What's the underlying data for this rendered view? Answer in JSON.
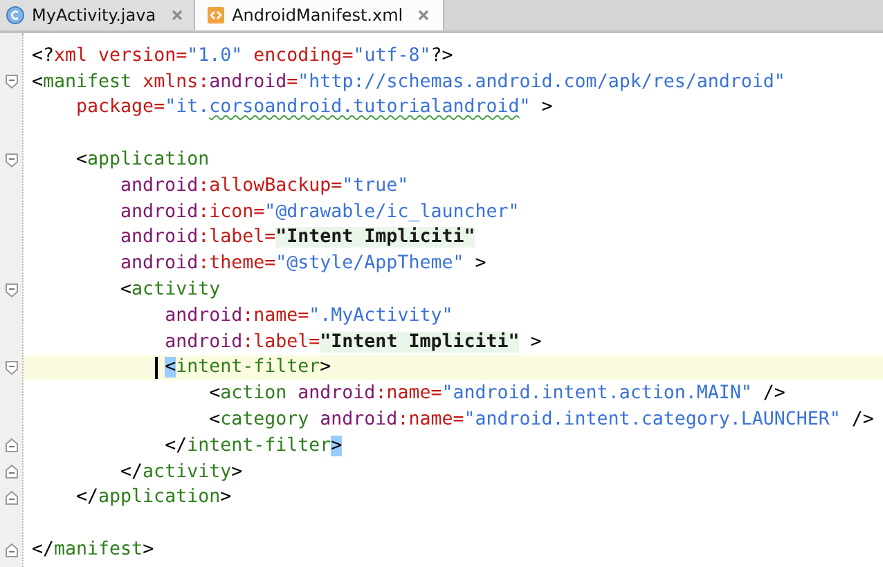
{
  "tabs": [
    {
      "label": "MyActivity.java",
      "kind": "java",
      "selected": false
    },
    {
      "label": "AndroidManifest.xml",
      "kind": "xml",
      "selected": true
    }
  ],
  "lines": [
    {
      "kind": "text",
      "tokens": [
        {
          "kind": "punct",
          "text": "<?"
        },
        {
          "kind": "attr",
          "text": "xml version"
        },
        {
          "kind": "attr",
          "text": "="
        },
        {
          "kind": "value",
          "text": "\"1.0\""
        },
        {
          "kind": "attr",
          "text": " encoding"
        },
        {
          "kind": "attr",
          "text": "="
        },
        {
          "kind": "value",
          "text": "\"utf-8\""
        },
        {
          "kind": "punct",
          "text": "?>"
        }
      ]
    },
    {
      "kind": "fold-start",
      "tokens": [
        {
          "kind": "punct",
          "text": "<"
        },
        {
          "kind": "tag",
          "text": "manifest"
        },
        {
          "kind": "attr",
          "text": " xmlns:"
        },
        {
          "kind": "ns",
          "text": "android"
        },
        {
          "kind": "attr",
          "text": "="
        },
        {
          "kind": "value",
          "text": "\"http://schemas.android.com/apk/res/android\""
        }
      ]
    },
    {
      "kind": "text",
      "tokens": [
        {
          "kind": "attr",
          "text": "package"
        },
        {
          "kind": "attr",
          "text": "="
        },
        {
          "kind": "value",
          "text": "\"it."
        },
        {
          "kind": "spell",
          "text": "corsoandroid.tutorialandroid"
        },
        {
          "kind": "value",
          "text": "\""
        },
        {
          "kind": "punct",
          "text": " >"
        }
      ]
    },
    {
      "kind": "blank"
    },
    {
      "kind": "fold-start",
      "tokens": [
        {
          "kind": "punct",
          "text": "<"
        },
        {
          "kind": "tag",
          "text": "application"
        }
      ]
    },
    {
      "kind": "text",
      "tokens": [
        {
          "kind": "ns",
          "text": "android"
        },
        {
          "kind": "attr",
          "text": ":allowBackup="
        },
        {
          "kind": "value",
          "text": "\"true\""
        }
      ]
    },
    {
      "kind": "text",
      "tokens": [
        {
          "kind": "ns",
          "text": "android"
        },
        {
          "kind": "attr",
          "text": ":icon="
        },
        {
          "kind": "value",
          "text": "\"@drawable/ic_launcher\""
        }
      ]
    },
    {
      "kind": "text",
      "tokens": [
        {
          "kind": "ns",
          "text": "android"
        },
        {
          "kind": "attr",
          "text": ":label="
        },
        {
          "kind": "label",
          "text": "\"Intent Impliciti\""
        }
      ]
    },
    {
      "kind": "text",
      "tokens": [
        {
          "kind": "ns",
          "text": "android"
        },
        {
          "kind": "attr",
          "text": ":theme="
        },
        {
          "kind": "value",
          "text": "\"@style/AppTheme\""
        },
        {
          "kind": "punct",
          "text": " >"
        }
      ]
    },
    {
      "kind": "fold-start",
      "tokens": [
        {
          "kind": "punct",
          "text": "<"
        },
        {
          "kind": "tag",
          "text": "activity"
        }
      ]
    },
    {
      "kind": "text",
      "tokens": [
        {
          "kind": "ns",
          "text": "android"
        },
        {
          "kind": "attr",
          "text": ":name="
        },
        {
          "kind": "value",
          "text": "\".MyActivity\""
        }
      ]
    },
    {
      "kind": "text",
      "tokens": [
        {
          "kind": "ns",
          "text": "android"
        },
        {
          "kind": "attr",
          "text": ":label="
        },
        {
          "kind": "label",
          "text": "\"Intent Impliciti\""
        },
        {
          "kind": "punct",
          "text": " >"
        }
      ]
    },
    {
      "kind": "fold-start",
      "current": true,
      "tokens": [
        {
          "kind": "caret"
        },
        {
          "kind": "match",
          "text": "<"
        },
        {
          "kind": "tag",
          "text": "intent-filter"
        },
        {
          "kind": "punct",
          "text": ">"
        }
      ]
    },
    {
      "kind": "text",
      "tokens": [
        {
          "kind": "punct",
          "text": "<"
        },
        {
          "kind": "tag",
          "text": "action"
        },
        {
          "kind": "ns",
          "text": " android"
        },
        {
          "kind": "attr",
          "text": ":name="
        },
        {
          "kind": "value",
          "text": "\"android.intent.action.MAIN\""
        },
        {
          "kind": "punct",
          "text": " />"
        }
      ]
    },
    {
      "kind": "text",
      "tokens": [
        {
          "kind": "punct",
          "text": "<"
        },
        {
          "kind": "tag",
          "text": "category"
        },
        {
          "kind": "ns",
          "text": " android"
        },
        {
          "kind": "attr",
          "text": ":name="
        },
        {
          "kind": "value",
          "text": "\"android.intent.category.LAUNCHER\""
        },
        {
          "kind": "punct",
          "text": " />"
        }
      ]
    },
    {
      "kind": "fold-end",
      "tokens": [
        {
          "kind": "punct",
          "text": "</"
        },
        {
          "kind": "tag",
          "text": "intent-filter"
        },
        {
          "kind": "match",
          "text": ">"
        }
      ]
    },
    {
      "kind": "fold-end",
      "tokens": [
        {
          "kind": "punct",
          "text": "</"
        },
        {
          "kind": "tag",
          "text": "activity"
        },
        {
          "kind": "punct",
          "text": ">"
        }
      ]
    },
    {
      "kind": "fold-end",
      "tokens": [
        {
          "kind": "punct",
          "text": "</"
        },
        {
          "kind": "tag",
          "text": "application"
        },
        {
          "kind": "punct",
          "text": ">"
        }
      ]
    },
    {
      "kind": "blank"
    },
    {
      "kind": "fold-end",
      "tokens": [
        {
          "kind": "punct",
          "text": "</"
        },
        {
          "kind": "tag",
          "text": "manifest"
        },
        {
          "kind": "punct",
          "text": ">"
        }
      ]
    }
  ]
}
